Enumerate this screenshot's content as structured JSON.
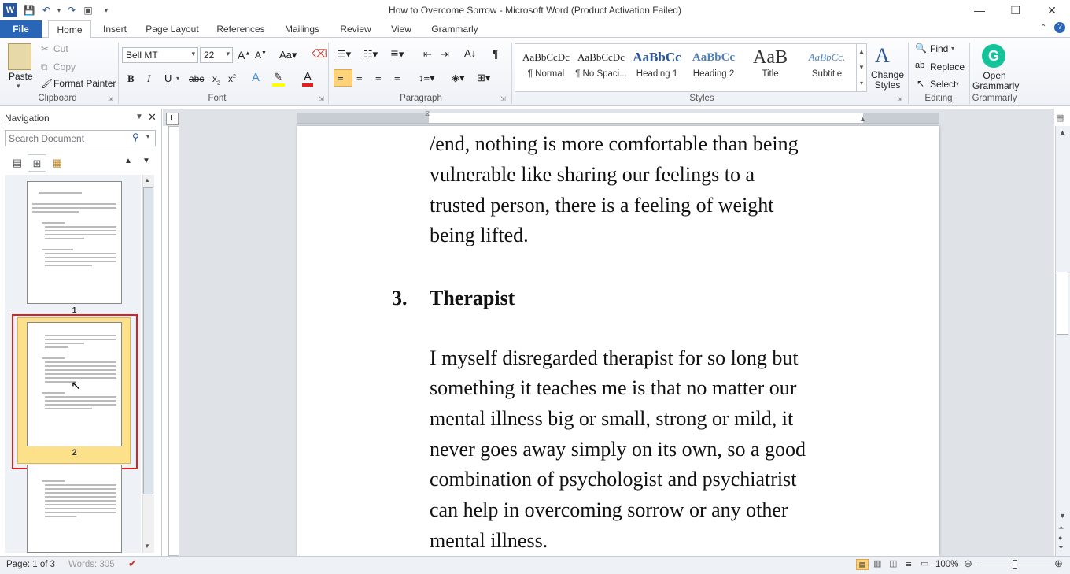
{
  "window": {
    "title": "How to Overcome Sorrow  -  Microsoft Word (Product Activation Failed)",
    "app_icon": "W"
  },
  "tabs": [
    {
      "label": "File"
    },
    {
      "label": "Home"
    },
    {
      "label": "Insert"
    },
    {
      "label": "Page Layout"
    },
    {
      "label": "References"
    },
    {
      "label": "Mailings"
    },
    {
      "label": "Review"
    },
    {
      "label": "View"
    },
    {
      "label": "Grammarly"
    }
  ],
  "ribbon": {
    "clipboard": {
      "label": "Clipboard",
      "paste": "Paste",
      "cut": "Cut",
      "copy": "Copy",
      "format_painter": "Format Painter"
    },
    "font": {
      "label": "Font",
      "font_name": "Bell MT",
      "font_size": "22"
    },
    "paragraph": {
      "label": "Paragraph"
    },
    "styles": {
      "label": "Styles",
      "items": [
        {
          "sample": "AaBbCcDc",
          "name": "¶ Normal"
        },
        {
          "sample": "AaBbCcDc",
          "name": "¶ No Spaci..."
        },
        {
          "sample": "AaBbCc",
          "name": "Heading 1"
        },
        {
          "sample": "AaBbCc",
          "name": "Heading 2"
        },
        {
          "sample": "AaB",
          "name": "Title"
        },
        {
          "sample": "AaBbCc.",
          "name": "Subtitle"
        }
      ],
      "change_styles": "Change Styles"
    },
    "editing": {
      "label": "Editing",
      "find": "Find",
      "replace": "Replace",
      "select": "Select"
    },
    "grammarly": {
      "label": "Grammarly",
      "open": "Open Grammarly"
    }
  },
  "navigation": {
    "title": "Navigation",
    "search_placeholder": "Search Document",
    "page_numbers": [
      "1",
      "2"
    ]
  },
  "document": {
    "lines_top": [
      "/end, nothing is more comfortable than being",
      "vulnerable like sharing our feelings to a",
      "trusted person, there is a feeling of weight",
      "being lifted."
    ],
    "heading_number": "3.",
    "heading_text": "Therapist",
    "lines_body": [
      "I myself disregarded therapist for so long but",
      "something it teaches me is that no matter our",
      "mental illness big or small, strong or mild, it",
      "never goes away simply on its own, so a good",
      "combination of psychologist and psychiatrist",
      "can help in overcoming sorrow or any other",
      "mental illness."
    ]
  },
  "status": {
    "page": "Page: 1 of 3",
    "words": "Words: 305",
    "zoom": "100%"
  },
  "colors": {
    "accent": "#2a66b8",
    "highlight_border": "#e0201f",
    "thumb_selected": "#fde18a"
  }
}
